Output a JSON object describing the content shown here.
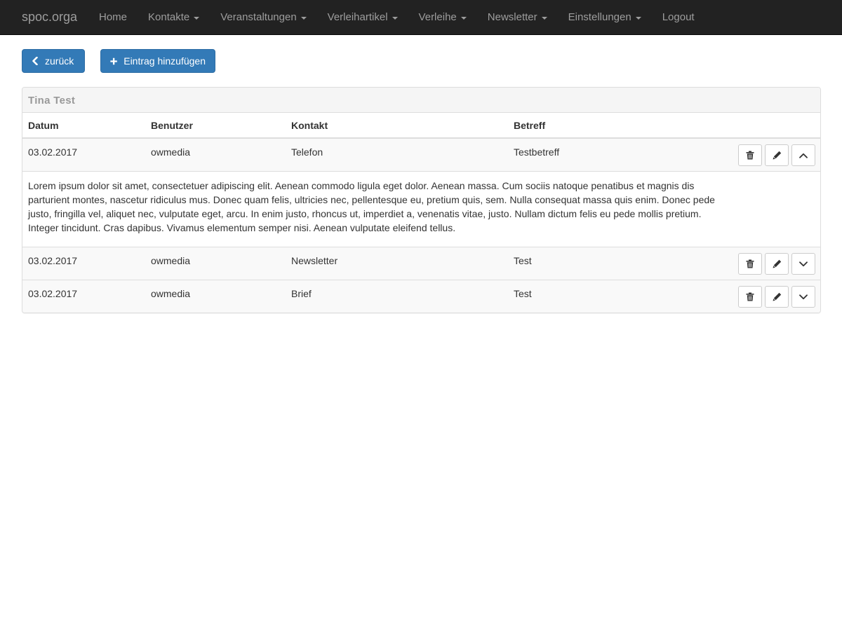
{
  "navbar": {
    "brand": "spoc.orga",
    "items": [
      {
        "label": "Home",
        "dropdown": false
      },
      {
        "label": "Kontakte",
        "dropdown": true
      },
      {
        "label": "Veranstaltungen",
        "dropdown": true
      },
      {
        "label": "Verleihartikel",
        "dropdown": true
      },
      {
        "label": "Verleihe",
        "dropdown": true
      },
      {
        "label": "Newsletter",
        "dropdown": true
      },
      {
        "label": "Einstellungen",
        "dropdown": true
      },
      {
        "label": "Logout",
        "dropdown": false
      }
    ]
  },
  "toolbar": {
    "back_label": "zurück",
    "add_label": "Eintrag hinzufügen"
  },
  "panel": {
    "title": "Tina Test",
    "columns": [
      "Datum",
      "Benutzer",
      "Kontakt",
      "Betreff"
    ],
    "rows": [
      {
        "datum": "03.02.2017",
        "benutzer": "owmedia",
        "kontakt": "Telefon",
        "betreff": "Testbetreff",
        "expanded": true
      },
      {
        "datum": "03.02.2017",
        "benutzer": "owmedia",
        "kontakt": "Newsletter",
        "betreff": "Test",
        "expanded": false
      },
      {
        "datum": "03.02.2017",
        "benutzer": "owmedia",
        "kontakt": "Brief",
        "betreff": "Test",
        "expanded": false
      }
    ],
    "detail_text": "Lorem ipsum dolor sit amet, consectetuer adipiscing elit. Aenean commodo ligula eget dolor. Aenean massa. Cum sociis natoque penatibus et magnis dis parturient montes, nascetur ridiculus mus. Donec quam felis, ultricies nec, pellentesque eu, pretium quis, sem. Nulla consequat massa quis enim. Donec pede justo, fringilla vel, aliquet nec, vulputate eget, arcu. In enim justo, rhoncus ut, imperdiet a, venenatis vitae, justo. Nullam dictum felis eu pede mollis pretium. Integer tincidunt. Cras dapibus. Vivamus elementum semper nisi. Aenean vulputate eleifend tellus."
  },
  "icons": {
    "back": "chevron-left-icon",
    "add": "plus-icon",
    "delete": "trash-icon",
    "edit": "pencil-icon",
    "collapse": "chevron-up-icon",
    "expand": "chevron-down-icon"
  },
  "colors": {
    "navbar_bg": "#222222",
    "nav_text": "#9d9d9d",
    "primary": "#337ab7",
    "panel_heading_bg": "#f5f5f5",
    "row_striped_bg": "#f9f9f9"
  }
}
